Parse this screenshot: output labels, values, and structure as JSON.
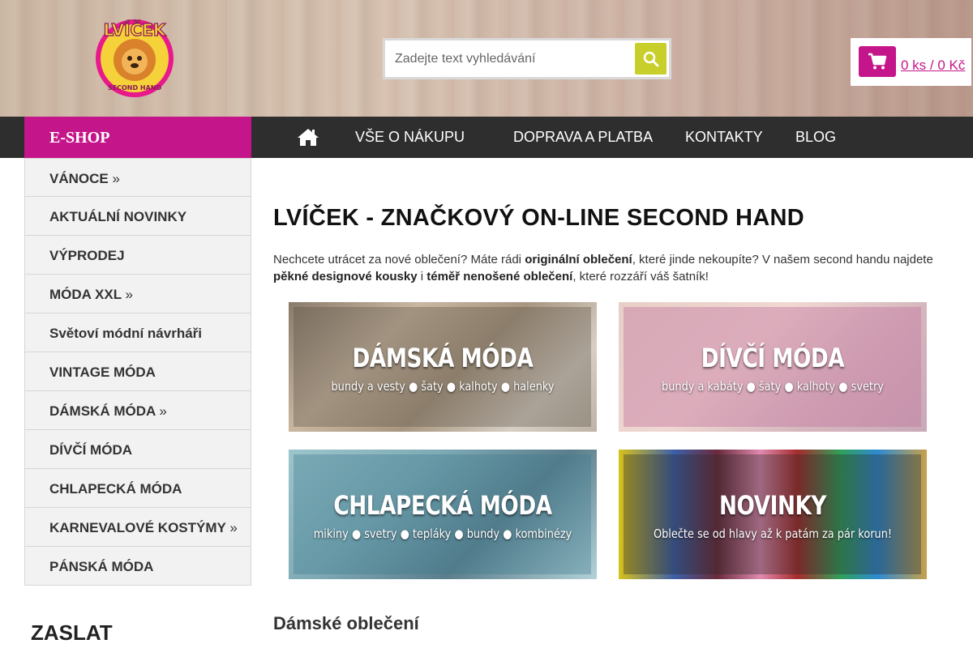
{
  "header": {
    "logo_text": "LVÍČEK",
    "logo_subtext": "SECOND HAND",
    "search_placeholder": "Zadejte text vyhledávání",
    "cart_text": "0 ks / 0 Kč"
  },
  "nav": {
    "eshop_label": "E-SHOP",
    "items": [
      "VŠE O NÁKUPU",
      "DOPRAVA A PLATBA",
      "KONTAKTY",
      "BLOG"
    ]
  },
  "sidebar": {
    "items": [
      {
        "label": "VÁNOCE",
        "arrow": "»"
      },
      {
        "label": "AKTUÁLNÍ NOVINKY",
        "arrow": ""
      },
      {
        "label": "VÝPRODEJ",
        "arrow": ""
      },
      {
        "label": "MÓDA XXL",
        "arrow": "»"
      },
      {
        "label": "Světoví módní návrháři",
        "arrow": ""
      },
      {
        "label": "VINTAGE MÓDA",
        "arrow": ""
      },
      {
        "label": "DÁMSKÁ MÓDA",
        "arrow": "»"
      },
      {
        "label": "DÍVČÍ MÓDA",
        "arrow": ""
      },
      {
        "label": "CHLAPECKÁ MÓDA",
        "arrow": ""
      },
      {
        "label": "KARNEVALOVÉ KOSTÝMY",
        "arrow": "»"
      },
      {
        "label": "PÁNSKÁ MÓDA",
        "arrow": ""
      }
    ],
    "zaslat": "ZASLAT"
  },
  "main": {
    "title": "LVÍČEK - ZNAČKOVÝ ON-LINE SECOND HAND",
    "intro": {
      "p1": "Nechcete utrácet za nové oblečení? Máte rádi ",
      "b1": "originální oblečení",
      "p2": ", které jinde nekoupíte? V našem second handu najdete ",
      "b2": "pěkné designové kousky",
      "p3": " i ",
      "b3": "téměř nenošené oblečení",
      "p4": ", které rozzáří váš šatník!"
    },
    "tiles": [
      {
        "title": "DÁMSKÁ MÓDA",
        "subtitle": "bundy a vesty ● šaty ● kalhoty ● halenky"
      },
      {
        "title": "DÍVČÍ MÓDA",
        "subtitle": "bundy a kabáty ● šaty ● kalhoty ● svetry"
      },
      {
        "title": "CHLAPECKÁ MÓDA",
        "subtitle": "mikiny ● svetry ● tepláky ● bundy ● kombinézy"
      },
      {
        "title": "NOVINKY",
        "subtitle": "Oblečte se od hlavy až k patám za pár korun!"
      }
    ],
    "section_heading": "Dámské oblečení"
  },
  "colors": {
    "accent": "#c4168a",
    "search_button": "#c8cf2a",
    "navbar": "#2e2e2e"
  }
}
